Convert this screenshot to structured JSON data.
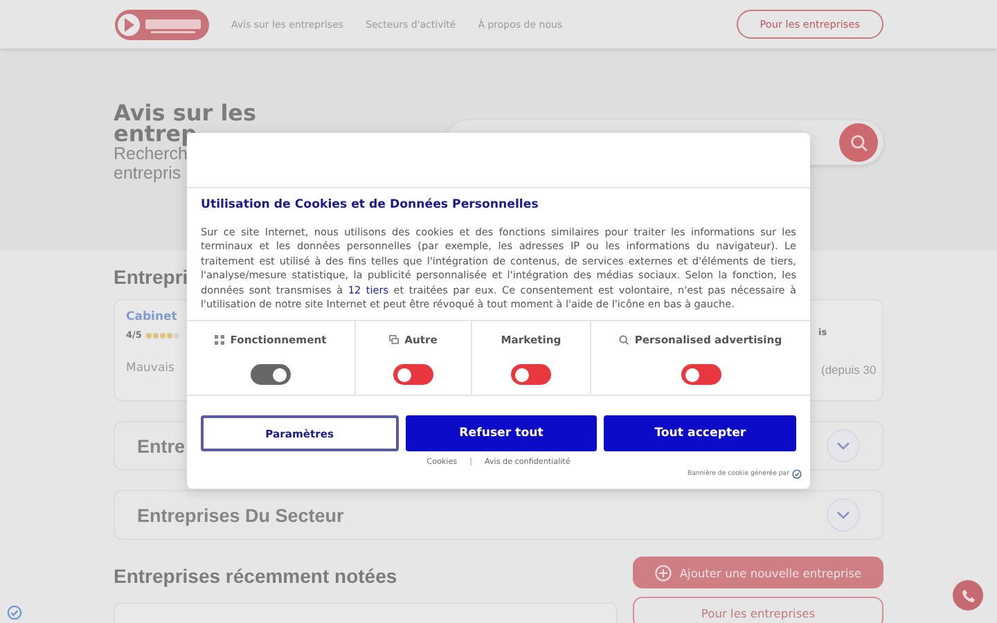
{
  "header": {
    "nav": [
      "Avis sur les entreprises",
      "Secteurs d'activité",
      "À propos de nous"
    ],
    "cta": "Pour les entreprises"
  },
  "hero": {
    "title_line_1": "Avis sur les",
    "title_line_2": "entrep",
    "subtitle_line_1": "Recherch",
    "subtitle_line_2": "entrepris"
  },
  "featured": {
    "heading": "Entrepri",
    "left_card": {
      "name": "Cabinet",
      "score": "4/5",
      "stars": 4,
      "excerpt": "Mauvais"
    },
    "right_card": {
      "name": "is",
      "excerpt": "(depuis 30"
    }
  },
  "accordions": [
    {
      "title": "Entre",
      "expanded": false
    },
    {
      "title": "Entreprises Du Secteur",
      "expanded": false
    }
  ],
  "recent": {
    "heading": "Entreprises récemment notées",
    "add_button": "Ajouter une nouvelle entreprise",
    "business_button": "Pour les entreprises"
  },
  "cookie_dialog": {
    "title": "Utilisation de Cookies et de Données Personnelles",
    "text": "Sur ce site Internet, nous utilisons des cookies et des fonctions similaires pour traiter les informations sur les terminaux et les données personnelles (par exemple, les adresses IP ou les informations du navigateur). Le traitement est utilisé à des fins telles que l'intégration de contenus, de services externes et d'éléments de tiers, l'analyse/mesure statistique, la publicité personnalisée et l'intégration des médias sociaux. Selon la fonction, les données sont transmises à ",
    "link": "12 tiers",
    "text_after": " et traitées par eux. Ce consentement est volontaire, n'est pas nécessaire à l'utilisation de notre site Internet et peut être révoqué à tout moment à l'aide de l'icône en bas à gauche.",
    "categories": [
      {
        "label": "Fonctionnement",
        "on": true
      },
      {
        "label": "Autre",
        "on": false
      },
      {
        "label": "Marketing",
        "on": false
      },
      {
        "label": "Personalised advertising",
        "on": false
      }
    ],
    "buttons": [
      {
        "label": "Paramètres",
        "kind": "outline"
      },
      {
        "label": "Refuser tout",
        "kind": "solid"
      },
      {
        "label": "Tout accepter",
        "kind": "solid"
      }
    ],
    "links": [
      "Cookies",
      "|",
      "Avis de confidentialité"
    ],
    "footer": "Bannière de cookie générée par"
  }
}
